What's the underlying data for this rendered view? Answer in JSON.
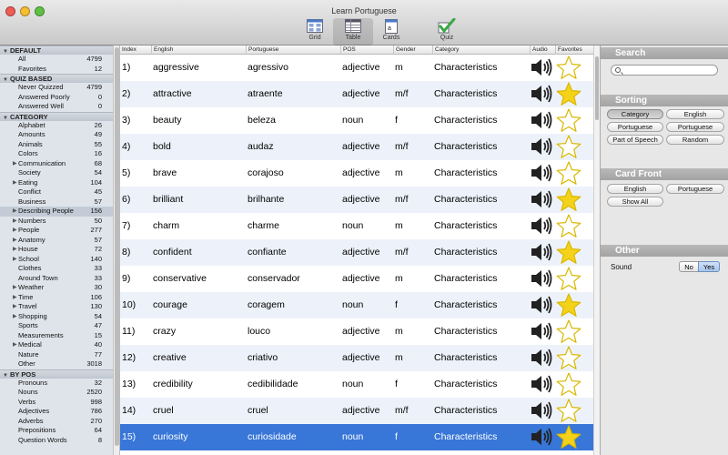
{
  "window": {
    "title": "Learn Portuguese"
  },
  "toolbar": [
    {
      "label": "Grid",
      "icon": "grid-icon",
      "selected": false
    },
    {
      "label": "Table",
      "icon": "table-icon",
      "selected": true
    },
    {
      "label": "Cards",
      "icon": "cards-icon",
      "selected": false
    },
    {
      "label": "Quiz",
      "icon": "quiz-check-icon",
      "selected": false
    }
  ],
  "sidebar": {
    "sections": [
      {
        "title": "DEFAULT",
        "items": [
          {
            "label": "All",
            "count": "4799"
          },
          {
            "label": "Favorites",
            "count": "12"
          }
        ]
      },
      {
        "title": "QUIZ BASED",
        "items": [
          {
            "label": "Never Quizzed",
            "count": "4799"
          },
          {
            "label": "Answered Poorly",
            "count": "0"
          },
          {
            "label": "Answered Well",
            "count": "0"
          }
        ]
      },
      {
        "title": "CATEGORY",
        "items": [
          {
            "label": "Alphabet",
            "count": "26"
          },
          {
            "label": "Amounts",
            "count": "49"
          },
          {
            "label": "Animals",
            "count": "55"
          },
          {
            "label": "Colors",
            "count": "16"
          },
          {
            "label": "Communication",
            "count": "68",
            "expandable": true
          },
          {
            "label": "Society",
            "count": "54"
          },
          {
            "label": "Eating",
            "count": "104",
            "expandable": true
          },
          {
            "label": "Conflict",
            "count": "45"
          },
          {
            "label": "Business",
            "count": "57"
          },
          {
            "label": "Describing People",
            "count": "156",
            "expandable": true,
            "selected": true
          },
          {
            "label": "Numbers",
            "count": "50",
            "expandable": true
          },
          {
            "label": "People",
            "count": "277",
            "expandable": true
          },
          {
            "label": "Anatomy",
            "count": "57",
            "expandable": true
          },
          {
            "label": "House",
            "count": "72",
            "expandable": true
          },
          {
            "label": "School",
            "count": "140",
            "expandable": true
          },
          {
            "label": "Clothes",
            "count": "33"
          },
          {
            "label": "Around Town",
            "count": "33"
          },
          {
            "label": "Weather",
            "count": "30",
            "expandable": true
          },
          {
            "label": "Time",
            "count": "106",
            "expandable": true
          },
          {
            "label": "Travel",
            "count": "130",
            "expandable": true
          },
          {
            "label": "Shopping",
            "count": "54",
            "expandable": true
          },
          {
            "label": "Sports",
            "count": "47"
          },
          {
            "label": "Measurements",
            "count": "15"
          },
          {
            "label": "Medical",
            "count": "40",
            "expandable": true
          },
          {
            "label": "Nature",
            "count": "77"
          },
          {
            "label": "Other",
            "count": "3018"
          }
        ]
      },
      {
        "title": "BY POS",
        "items": [
          {
            "label": "Pronouns",
            "count": "32"
          },
          {
            "label": "Nouns",
            "count": "2520"
          },
          {
            "label": "Verbs",
            "count": "998"
          },
          {
            "label": "Adjectives",
            "count": "786"
          },
          {
            "label": "Adverbs",
            "count": "270"
          },
          {
            "label": "Prepositions",
            "count": "64"
          },
          {
            "label": "Question Words",
            "count": "8"
          }
        ]
      }
    ]
  },
  "table": {
    "columns": [
      "Index",
      "English",
      "Portuguese",
      "POS",
      "Gender",
      "Category",
      "Audio",
      "Favorites"
    ],
    "rows": [
      {
        "index": "1)",
        "english": "aggressive",
        "portuguese": "agressivo",
        "pos": "adjective",
        "gender": "m",
        "category": "Characteristics",
        "favorite": false
      },
      {
        "index": "2)",
        "english": "attractive",
        "portuguese": "atraente",
        "pos": "adjective",
        "gender": "m/f",
        "category": "Characteristics",
        "favorite": true
      },
      {
        "index": "3)",
        "english": "beauty",
        "portuguese": "beleza",
        "pos": "noun",
        "gender": "f",
        "category": "Characteristics",
        "favorite": false
      },
      {
        "index": "4)",
        "english": "bold",
        "portuguese": "audaz",
        "pos": "adjective",
        "gender": "m/f",
        "category": "Characteristics",
        "favorite": false
      },
      {
        "index": "5)",
        "english": "brave",
        "portuguese": "corajoso",
        "pos": "adjective",
        "gender": "m",
        "category": "Characteristics",
        "favorite": false
      },
      {
        "index": "6)",
        "english": "brilliant",
        "portuguese": "brilhante",
        "pos": "adjective",
        "gender": "m/f",
        "category": "Characteristics",
        "favorite": true
      },
      {
        "index": "7)",
        "english": "charm",
        "portuguese": "charme",
        "pos": "noun",
        "gender": "m",
        "category": "Characteristics",
        "favorite": false
      },
      {
        "index": "8)",
        "english": "confident",
        "portuguese": "confiante",
        "pos": "adjective",
        "gender": "m/f",
        "category": "Characteristics",
        "favorite": true
      },
      {
        "index": "9)",
        "english": "conservative",
        "portuguese": "conservador",
        "pos": "adjective",
        "gender": "m",
        "category": "Characteristics",
        "favorite": false
      },
      {
        "index": "10)",
        "english": "courage",
        "portuguese": "coragem",
        "pos": "noun",
        "gender": "f",
        "category": "Characteristics",
        "favorite": true
      },
      {
        "index": "11)",
        "english": "crazy",
        "portuguese": "louco",
        "pos": "adjective",
        "gender": "m",
        "category": "Characteristics",
        "favorite": false
      },
      {
        "index": "12)",
        "english": "creative",
        "portuguese": "criativo",
        "pos": "adjective",
        "gender": "m",
        "category": "Characteristics",
        "favorite": false
      },
      {
        "index": "13)",
        "english": "credibility",
        "portuguese": "cedibilidade",
        "pos": "noun",
        "gender": "f",
        "category": "Characteristics",
        "favorite": false
      },
      {
        "index": "14)",
        "english": "cruel",
        "portuguese": "cruel",
        "pos": "adjective",
        "gender": "m/f",
        "category": "Characteristics",
        "favorite": false
      },
      {
        "index": "15)",
        "english": "curiosity",
        "portuguese": "curiosidade",
        "pos": "noun",
        "gender": "f",
        "category": "Characteristics",
        "favorite": true,
        "selected": true
      }
    ]
  },
  "right_panel": {
    "search": {
      "title": "Search",
      "placeholder": ""
    },
    "sorting": {
      "title": "Sorting",
      "options": [
        "Category",
        "English",
        "Portuguese",
        "Portuguese",
        "Part of Speech",
        "Random"
      ],
      "active": "Category"
    },
    "card_front": {
      "title": "Card Front",
      "options": [
        "English",
        "Portuguese",
        "Show All"
      ]
    },
    "other": {
      "title": "Other",
      "sound_label": "Sound",
      "no": "No",
      "yes": "Yes",
      "sound_value": "Yes"
    }
  },
  "colors": {
    "selection": "#3876d8",
    "star": "#f5d21a",
    "header_bar": "#a9a9a9"
  }
}
